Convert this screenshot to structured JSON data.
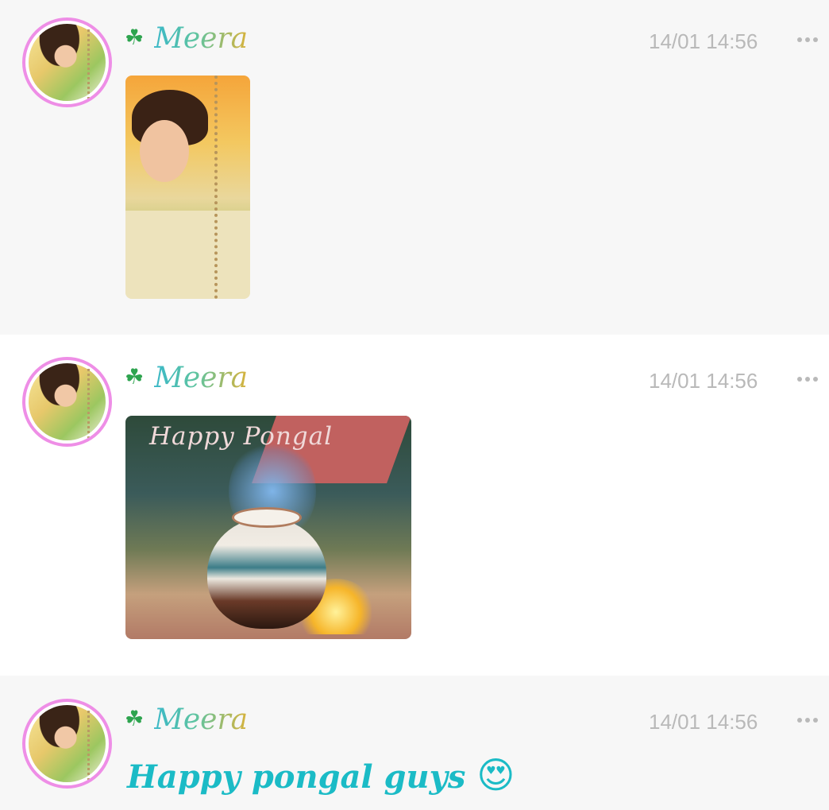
{
  "messages": [
    {
      "sender": "Meera",
      "sender_badge_icon": "clover-icon",
      "time": "14/01 14:56",
      "type": "image",
      "image_caption": ""
    },
    {
      "sender": "Meera",
      "sender_badge_icon": "clover-icon",
      "time": "14/01 14:56",
      "type": "image",
      "image_caption": "Happy Pongal"
    },
    {
      "sender": "Meera",
      "sender_badge_icon": "clover-icon",
      "time": "14/01 14:56",
      "type": "text",
      "text": "Happy pongal guys",
      "emoji": "😍"
    }
  ],
  "colors": {
    "avatar_ring": "#ee8ee6",
    "message_text": "#1bbbc6",
    "timestamp": "#b9b9b9"
  }
}
